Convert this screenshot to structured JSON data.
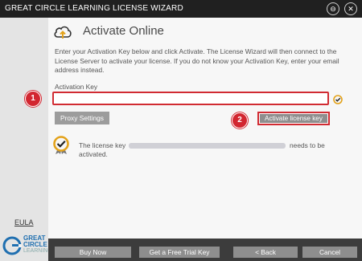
{
  "window": {
    "title": "GREAT CIRCLE LEARNING LICENSE WIZARD",
    "minimize_glyph": "⊖",
    "close_glyph": "✕"
  },
  "sidebar": {
    "eula": "EULA",
    "logo": {
      "line1": "GREAT",
      "line2": "CIRCLE",
      "line3": "LEARNING"
    }
  },
  "main": {
    "heading": "Activate Online",
    "description": "Enter your Activation Key below and click Activate. The License Wizard will then connect to the License Server to activate your license. If you do not know your Activation Key, enter your email address instead.",
    "key_label": "Activation Key",
    "key_value": "",
    "proxy_button": "Proxy Settings",
    "activate_button": "Activate license key",
    "status_prefix": "The license key",
    "status_suffix": "needs to be",
    "status_line2": "activated."
  },
  "annotations": {
    "badge1": "1",
    "badge2": "2"
  },
  "footer": {
    "buy_now": "Buy Now",
    "trial": "Get a Free Trial Key",
    "back": "< Back",
    "cancel": "Cancel"
  },
  "colors": {
    "accent_red": "#d12b32",
    "seal_gold": "#e3a21a",
    "logo_blue": "#1f6fb0",
    "titlebar": "#202020"
  },
  "icons": {
    "cloud": "cloud-upload-icon",
    "seal": "certificate-seal-icon",
    "logo": "great-circle-logo-icon"
  }
}
